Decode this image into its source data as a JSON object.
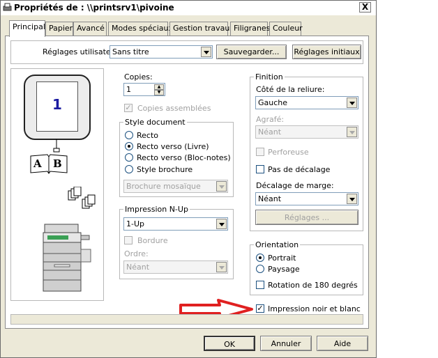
{
  "window": {
    "title": "Propriétés de : \\\\printsrv1\\pivoine",
    "close_label": "X"
  },
  "tabs": [
    "Principal",
    "Papier",
    "Avancé",
    "Modes spéciaux",
    "Gestion travaux",
    "Filigranes",
    "Couleur"
  ],
  "settings": {
    "label": "Réglages utilisateur:",
    "value": "Sans titre",
    "save_button": "Sauvegarder...",
    "defaults_button": "Réglages initiaux"
  },
  "preview": {
    "page_number": "1",
    "book_left": "A",
    "book_right": "B"
  },
  "copies": {
    "label": "Copies:",
    "value": "1",
    "collate_label": "Copies assemblées",
    "collate_checked": true,
    "collate_disabled": true
  },
  "document_style": {
    "legend": "Style document",
    "options": [
      "Recto",
      "Recto verso (Livre)",
      "Recto verso (Bloc-notes)",
      "Style brochure"
    ],
    "selected": 1,
    "brochure_value": "Brochure mosaïque"
  },
  "nup": {
    "legend": "Impression N-Up",
    "value": "1-Up",
    "border_label": "Bordure",
    "order_label": "Ordre:",
    "order_value": "Néant"
  },
  "finishing": {
    "legend": "Finition",
    "binding_label": "Côté de la reliure:",
    "binding_value": "Gauche",
    "staple_label": "Agrafé:",
    "staple_value": "Néant",
    "punch_label": "Perforeuse",
    "offset_label": "Pas de décalage",
    "margin_label": "Décalage de marge:",
    "margin_value": "Néant",
    "settings_button": "Réglages ..."
  },
  "orientation": {
    "legend": "Orientation",
    "options": [
      "Portrait",
      "Paysage"
    ],
    "selected": 0,
    "rotate_label": "Rotation de 180 degrés"
  },
  "bw": {
    "label": "Impression noir et blanc",
    "checked": true
  },
  "buttons": {
    "ok": "OK",
    "cancel": "Annuler",
    "help": "Aide"
  },
  "colors": {
    "annotation_arrow": "#e02020",
    "window_bg": "#ece9d8"
  }
}
